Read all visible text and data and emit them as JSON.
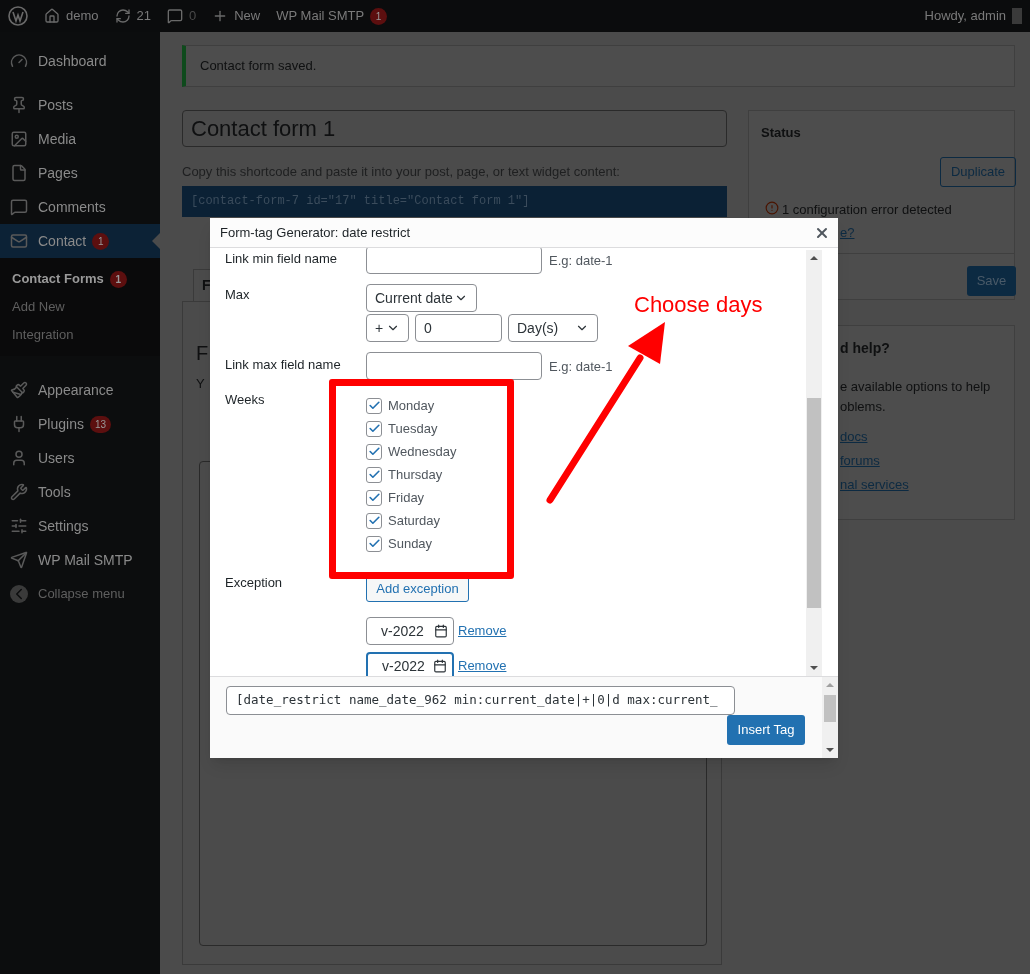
{
  "admin_bar": {
    "site": "demo",
    "updates": "21",
    "comments": "0",
    "new": "New",
    "plugin": {
      "label": "WP Mail SMTP",
      "badge": "1"
    },
    "greeting": "Howdy, admin"
  },
  "sidebar": {
    "sections": [
      [
        {
          "label": "Dashboard",
          "selected": false
        }
      ],
      [
        {
          "label": "Posts",
          "selected": false
        },
        {
          "label": "Media",
          "selected": false
        },
        {
          "label": "Pages",
          "selected": false
        },
        {
          "label": "Comments",
          "selected": false
        },
        {
          "label": "Contact",
          "badge": "1",
          "selected": true,
          "children": [
            {
              "label": "Contact Forms",
              "badge": "1",
              "selected": true
            },
            {
              "label": "Add New",
              "selected": false
            },
            {
              "label": "Integration",
              "selected": false
            }
          ]
        }
      ],
      [
        {
          "label": "Appearance",
          "selected": false
        },
        {
          "label": "Plugins",
          "badge": "13",
          "selected": false
        },
        {
          "label": "Users",
          "selected": false
        },
        {
          "label": "Tools",
          "selected": false
        },
        {
          "label": "Settings",
          "selected": false
        },
        {
          "label": "WP Mail SMTP",
          "selected": false
        }
      ]
    ],
    "collapse": "Collapse menu"
  },
  "notice": "Contact form saved.",
  "title_field": {
    "value": "Contact form 1"
  },
  "shortcode_hint": "Copy this shortcode and paste it into your post, page, or text widget content:",
  "shortcode": "[contact-form-7 id=\"17\" title=\"Contact form 1\"]",
  "editor": {
    "tab_fragment": "F",
    "heading_fragment": "F",
    "text_fragment": "Y"
  },
  "status_panel": {
    "title": "Status",
    "duplicate": "Duplicate",
    "error": "1 configuration error detected",
    "link_fragment": "e?",
    "save": "Save"
  },
  "help_panel": {
    "title_fragment": "d help?",
    "text_lines": [
      "e available options to help",
      "oblems."
    ],
    "links": [
      "docs",
      "forums",
      "nal services"
    ]
  },
  "modal": {
    "title": "Form-tag Generator: date restrict",
    "rows": [
      {
        "kind": "text_input",
        "label": "Link min field name",
        "hint": "E.g: date-1"
      },
      {
        "kind": "date_offset",
        "label": "Max",
        "base": "Current date",
        "sign": "+",
        "amount": "0",
        "unit": "Day(s)"
      },
      {
        "kind": "text_input",
        "label": "Link max field name",
        "hint": "E.g: date-1"
      },
      {
        "kind": "checkbox_list",
        "label": "Weeks",
        "options": [
          {
            "label": "Monday",
            "checked": true
          },
          {
            "label": "Tuesday",
            "checked": true
          },
          {
            "label": "Wednesday",
            "checked": true
          },
          {
            "label": "Thursday",
            "checked": true
          },
          {
            "label": "Friday",
            "checked": true
          },
          {
            "label": "Saturday",
            "checked": true
          },
          {
            "label": "Sunday",
            "checked": true
          }
        ]
      },
      {
        "kind": "exception",
        "label": "Exception",
        "button": "Add exception",
        "dates": [
          {
            "value": "v-2022",
            "link": "Remove",
            "focused": false
          },
          {
            "value": "v-2022",
            "link": "Remove",
            "focused": true
          }
        ]
      }
    ],
    "tag": "[date_restrict name_date_962 min:current_date|+|0|d max:current_",
    "insert": "Insert Tag"
  },
  "annotation": {
    "text": "Choose days"
  }
}
